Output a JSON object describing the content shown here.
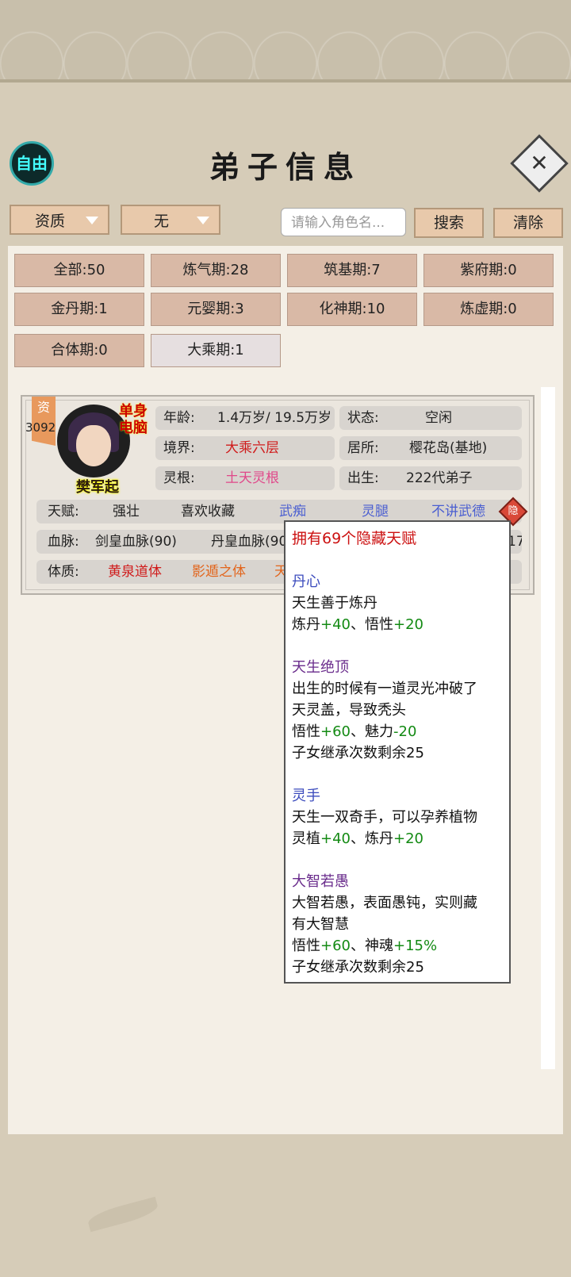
{
  "header": {
    "title": "弟子信息",
    "free_label": "自由",
    "close_label": "✕"
  },
  "filters": {
    "sort_value": "资质",
    "type_value": "无",
    "search_placeholder": "请输入角色名...",
    "search_label": "搜索",
    "clear_label": "清除"
  },
  "realm_chips": [
    "全部:50",
    "炼气期:28",
    "筑基期:7",
    "紫府期:0",
    "金丹期:1",
    "元婴期:3",
    "化神期:10",
    "炼虚期:0",
    "合体期:0",
    "大乘期:1"
  ],
  "disciple": {
    "qual_label": "资",
    "qual_value": "3092",
    "tag_line1": "单身",
    "tag_line2": "电脑",
    "name": "樊军起",
    "age_label": "年龄:",
    "age_value": "1.4万岁/ 19.5万岁",
    "status_label": "状态:",
    "status_value": "空闲",
    "realm_label": "境界:",
    "realm_value": "大乘六层",
    "residence_label": "居所:",
    "residence_value": "樱花岛(基地)",
    "root_label": "灵根:",
    "root_value": "土天灵根",
    "birth_label": "出生:",
    "birth_value": "222代弟子",
    "talent_label": "天赋:",
    "talents": [
      "强壮",
      "喜欢收藏",
      "武痴",
      "灵腿",
      "不讲武德"
    ],
    "hidden_label": "隐",
    "blood_label": "血脉:",
    "bloodlines": [
      "剑皇血脉(90)",
      "丹皇血脉(90",
      "17"
    ],
    "body_label": "体质:",
    "bodies": [
      "黄泉道体",
      "影遁之体",
      "天"
    ]
  },
  "tooltip": {
    "heading": "拥有69个隐藏天赋",
    "items": [
      {
        "name": "丹心",
        "desc": "天生善于炼丹",
        "effect_a": "炼丹",
        "val_a": "+40",
        "sep": "、",
        "effect_b": "悟性",
        "val_b": "+20"
      },
      {
        "name": "天生绝顶",
        "desc1": "出生的时候有一道灵光冲破了",
        "desc2": "天灵盖，导致秃头",
        "effect_a": "悟性",
        "val_a": "+60",
        "sep": "、",
        "effect_b": "魅力",
        "val_b": "-20",
        "extra": "子女继承次数剩余25"
      },
      {
        "name": "灵手",
        "desc": "天生一双奇手，可以孕养植物",
        "effect_a": "灵植",
        "val_a": "+40",
        "sep": "、",
        "effect_b": "炼丹",
        "val_b": "+20"
      },
      {
        "name": "大智若愚",
        "desc1": "大智若愚，表面愚钝，实则藏",
        "desc2": "有大智慧",
        "effect_a": "悟性",
        "val_a": "+60",
        "sep": "、",
        "effect_b": "神魂",
        "val_b": "+15%",
        "extra": "子女继承次数剩余25"
      }
    ]
  }
}
